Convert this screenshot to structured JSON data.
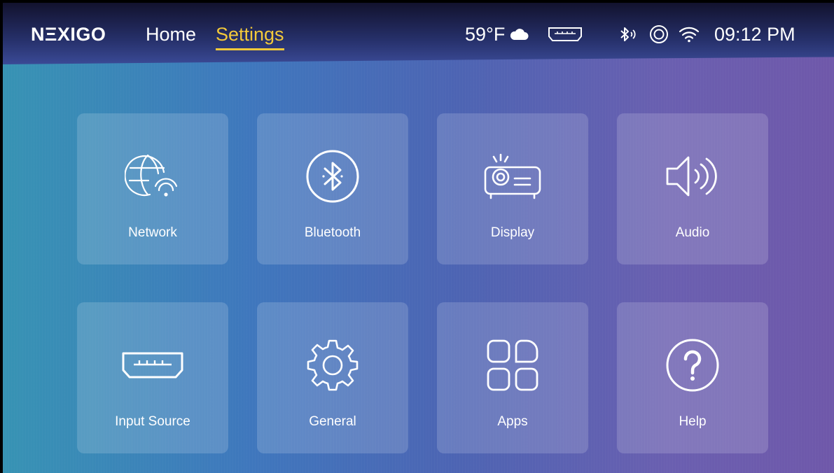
{
  "brand": {
    "logo_text": "NΞXIGO"
  },
  "nav": {
    "home_label": "Home",
    "settings_label": "Settings"
  },
  "status_bar": {
    "temperature": "59°F",
    "weather_icon": "cloud-icon",
    "input_icon": "hdmi-icon",
    "bluetooth_icon": "bluetooth-audio-icon",
    "assistant_icon": "target-icon",
    "wifi_icon": "wifi-icon",
    "time": "09:12 PM"
  },
  "colors": {
    "accent": "#f3c93a",
    "tile_bg": "rgba(255,255,255,0.16)",
    "gradient_left": "#3793b4",
    "gradient_right": "#6f58aa"
  },
  "tiles": [
    {
      "label": "Network",
      "icon": "globe-wifi-icon"
    },
    {
      "label": "Bluetooth",
      "icon": "bluetooth-icon"
    },
    {
      "label": "Display",
      "icon": "projector-icon"
    },
    {
      "label": "Audio",
      "icon": "speaker-icon"
    },
    {
      "label": "Input Source",
      "icon": "hdmi-port-icon"
    },
    {
      "label": "General",
      "icon": "gear-icon"
    },
    {
      "label": "Apps",
      "icon": "apps-grid-icon"
    },
    {
      "label": "Help",
      "icon": "help-icon"
    }
  ]
}
